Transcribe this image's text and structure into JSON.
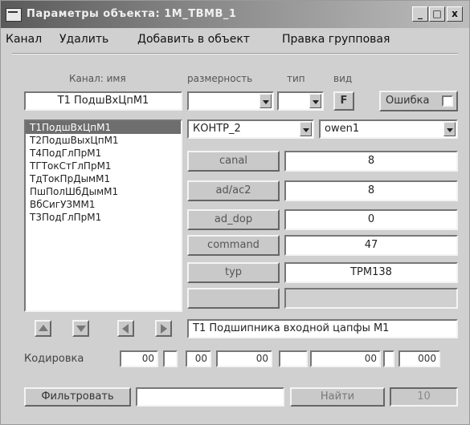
{
  "window": {
    "title": "Параметры объекта: 1М_ТВМВ_1",
    "min_glyph": "_",
    "max_glyph": "□",
    "close_glyph": "x"
  },
  "menu": [
    "Канал",
    "Удалить",
    "Добавить в объект",
    "Правка групповая"
  ],
  "labels": {
    "channel_name": "Канал: имя",
    "dimension": "размерность",
    "type": "тип",
    "view": "вид",
    "error": "Ошибка",
    "encoding": "Кодировка"
  },
  "channel_name_value": "T1 ПодшВхЦпМ1",
  "view_button": "F",
  "type_value": "",
  "dimension_value": "",
  "channels": [
    "Т1ПодшВхЦпМ1",
    "Т2ПодшВыхЦпМ1",
    "Т4ПодГлПрМ1",
    "ТГТокСтГлПрМ1",
    "ТдТокПрДымМ1",
    "ПшПолШбДымМ1",
    "ВбСигУЗММ1",
    "Т3ПодГлПрМ1"
  ],
  "selected_channel_index": 0,
  "controller_combo": "КОНТР_2",
  "device_combo": "owen1",
  "params": [
    {
      "label": "canal",
      "value": "8"
    },
    {
      "label": "ad/ac2",
      "value": "8"
    },
    {
      "label": "ad_dop",
      "value": "0"
    },
    {
      "label": "command",
      "value": "47"
    },
    {
      "label": "typ",
      "value": "ТРМ138"
    },
    {
      "label": "",
      "value": ""
    }
  ],
  "description": "Т1 Подшипника входной цапфы М1",
  "encoding_cells": [
    "00",
    "00",
    "00",
    "00",
    "000"
  ],
  "filter_button": "Фильтровать",
  "filter_value": "",
  "find_button": "Найти",
  "count_value": "10"
}
